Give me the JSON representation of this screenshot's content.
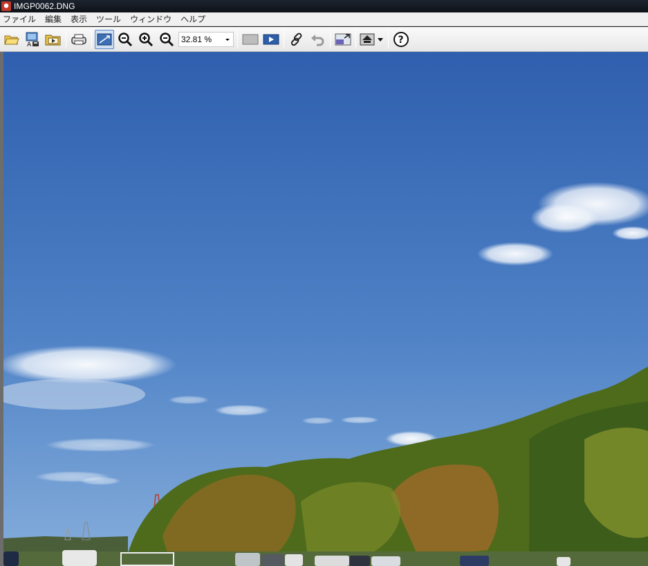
{
  "window": {
    "title": "IMGP0062.DNG",
    "icon": "app-icon"
  },
  "menu": {
    "items": [
      "ファイル",
      "編集",
      "表示",
      "ツール",
      "ウィンドウ",
      "ヘルプ"
    ]
  },
  "toolbar": {
    "buttons": [
      {
        "name": "open-folder-icon"
      },
      {
        "name": "save-as-icon"
      },
      {
        "name": "browse-folder-icon"
      },
      {
        "name": "print-icon"
      },
      {
        "name": "fit-to-window-icon",
        "active": true
      },
      {
        "name": "zoom-tool-icon"
      },
      {
        "name": "zoom-in-icon"
      },
      {
        "name": "zoom-out-icon"
      },
      {
        "name": "gray-view-icon"
      },
      {
        "name": "slideshow-icon"
      },
      {
        "name": "link-icon"
      },
      {
        "name": "undo-icon"
      },
      {
        "name": "compare-icon"
      },
      {
        "name": "output-icon"
      },
      {
        "name": "help-icon"
      }
    ],
    "zoom": {
      "value": "32.81 %"
    }
  },
  "viewer": {
    "image_name": "IMGP0062.DNG",
    "sky_top_color": "#2f5fae",
    "sky_bottom_color": "#86aedb",
    "hill_colors": [
      "#4e6b1c",
      "#8a6a22",
      "#3b5a1b",
      "#a46a2a"
    ]
  }
}
